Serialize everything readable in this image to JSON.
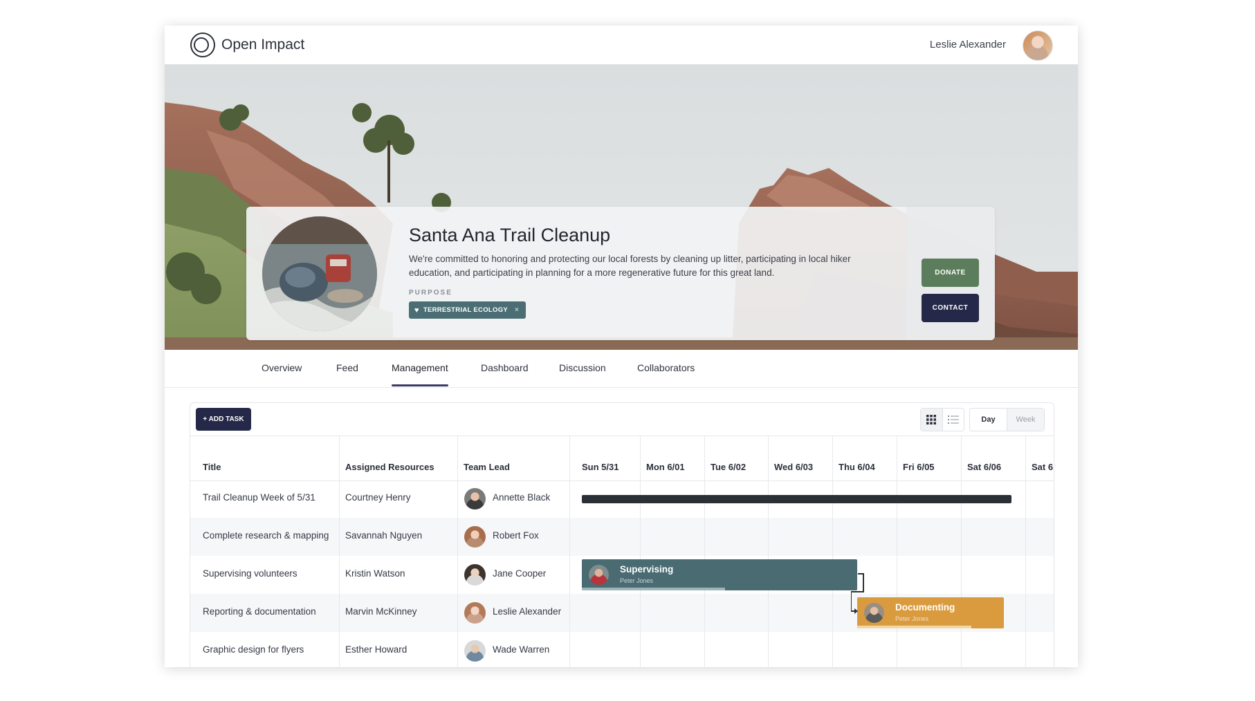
{
  "app": {
    "brand": "Open Impact",
    "user_name": "Leslie Alexander"
  },
  "project": {
    "title": "Santa Ana Trail Cleanup",
    "description": "We're committed to honoring and protecting our local forests by cleaning up litter, participating in local hiker education, and participating in planning for a more regenerative future for this great land.",
    "purpose_label": "PURPOSE",
    "tag": "TERRESTRIAL ECOLOGY",
    "tag_remove": "×",
    "donate_label": "DONATE",
    "contact_label": "CONTACT"
  },
  "tabs": [
    "Overview",
    "Feed",
    "Management",
    "Dashboard",
    "Discussion",
    "Collaborators"
  ],
  "active_tab": "Management",
  "toolbar": {
    "add_task": "+ ADD TASK",
    "range_day": "Day",
    "range_week": "Week"
  },
  "table": {
    "columns": [
      "Title",
      "Assigned Resources",
      "Team Lead"
    ],
    "days": [
      "Sun 5/31",
      "Mon 6/01",
      "Tue 6/02",
      "Wed 6/03",
      "Thu 6/04",
      "Fri 6/05",
      "Sat 6/06",
      "Sat 6"
    ],
    "rows": [
      {
        "title": "Trail Cleanup Week of 5/31",
        "resource": "Courtney Henry",
        "lead": "Annette Black"
      },
      {
        "title": "Complete research & mapping",
        "resource": "Savannah Nguyen",
        "lead": "Robert Fox"
      },
      {
        "title": "Supervising volunteers",
        "resource": "Kristin Watson",
        "lead": "Jane Cooper"
      },
      {
        "title": "Reporting & documentation",
        "resource": "Marvin McKinney",
        "lead": "Leslie Alexander"
      },
      {
        "title": "Graphic design for flyers",
        "resource": "Esther Howard",
        "lead": "Wade Warren"
      }
    ]
  },
  "gantt": {
    "supervising": {
      "title": "Supervising",
      "person": "Peter Jones",
      "progress": 0.52,
      "color": "#4a6b72"
    },
    "documenting": {
      "title": "Documenting",
      "person": "Peter Jones",
      "progress": 0.78,
      "color": "#d99b3e"
    }
  },
  "colors": {
    "primary": "#252848",
    "donate": "#5c7d5b",
    "tag": "#4b6e74"
  }
}
